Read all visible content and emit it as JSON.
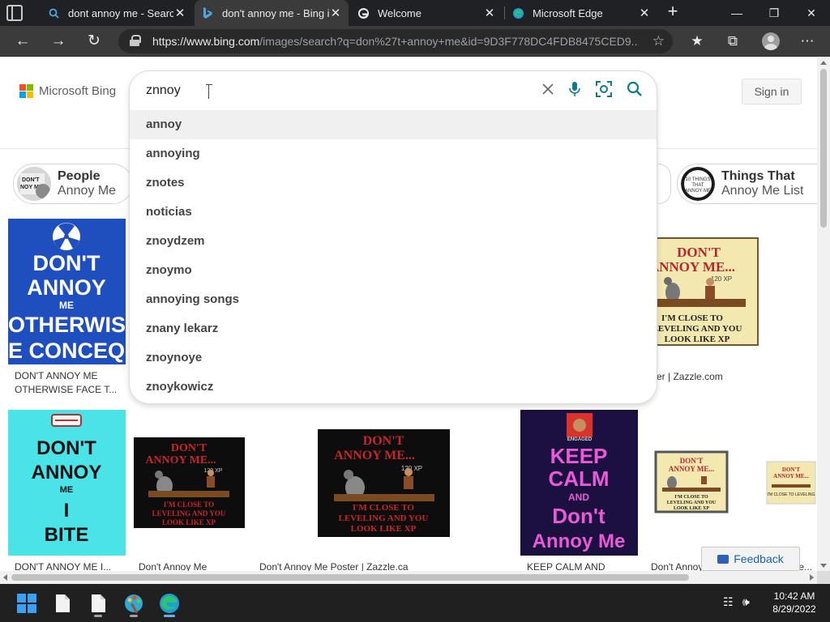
{
  "browser": {
    "tabs": [
      {
        "title": "dont annoy me - Search",
        "icon": "search-icon"
      },
      {
        "title": "don't annoy me - Bing images",
        "icon": "bing-icon"
      },
      {
        "title": "Welcome",
        "icon": "edge-icon"
      },
      {
        "title": "Microsoft Edge",
        "icon": "edge-icon"
      }
    ],
    "url_domain": "https://www.bing.com",
    "url_path": "/images/search?q=don%27t+annoy+me&id=9D3F778DC4FDB8475CED9..."
  },
  "page": {
    "brand": "Microsoft Bing",
    "sign_in": "Sign in",
    "feedback": "Feedback"
  },
  "search": {
    "query": "znnoy",
    "suggestions": [
      "annoy",
      "annoying",
      "znotes",
      "noticias",
      "znoydzem",
      "znoymo",
      "annoying songs",
      "znany lekarz",
      "znoynoye",
      "znoykowicz"
    ]
  },
  "chips": [
    {
      "line1": "People",
      "line2": "Annoy Me"
    },
    {
      "line1": "Things That",
      "line2": "Annoy Me List"
    }
  ],
  "chip_thumbs": {
    "things_list": [
      "10 THINGS",
      "THAT",
      "ANNOY ME"
    ],
    "people": [
      "DON'T",
      "NOY ME"
    ]
  },
  "results_row1": [
    {
      "caption": "DON'T ANNOY ME OTHERWISE FACE T...",
      "poster": [
        "DON'T",
        "ANNOY",
        "ME",
        "OTHERWISE",
        "E CONCEQU"
      ]
    },
    {
      "caption": "er | Zazzle.com",
      "poster": [
        "DON'T",
        "ANNOY ME...",
        "120 XP",
        "I'M CLOSE TO",
        "LEVELING AND YOU",
        "LOOK LIKE XP"
      ]
    }
  ],
  "results_row2": [
    {
      "caption": "DON'T ANNOY ME I...",
      "poster": [
        "DON'T",
        "ANNOY",
        "ME",
        "I",
        "BITE"
      ]
    },
    {
      "caption": "Don't Annoy Me Poster...",
      "poster": [
        "DON'T",
        "ANNOY ME...",
        "120 XP",
        "I'M CLOSE TO",
        "LEVELING AND YOU",
        "LOOK LIKE XP"
      ]
    },
    {
      "caption": "Don't Annoy Me Poster | Zazzle.ca",
      "poster": [
        "DON'T",
        "ANNOY ME...",
        "120 XP",
        "I'M CLOSE TO",
        "LEVELING AND YOU",
        "LOOK LIKE XP"
      ]
    },
    {
      "caption": "KEEP CALM AND Don't...",
      "poster": [
        "ENGAGED",
        "KEEP",
        "CALM",
        "AND",
        "Don't",
        "Annoy Me"
      ]
    },
    {
      "caption": "Don't Annoy...",
      "poster": [
        "DON'T",
        "ANNOY ME...",
        "I'M CLOSE TO",
        "LEVELING AND YOU",
        "LOOK LIKE XP"
      ]
    },
    {
      "caption": "y Me...",
      "poster": [
        "DON'T",
        "ANNOY ME...",
        "I'M CLOSE TO LEVELING"
      ]
    }
  ],
  "taskbar": {
    "time": "10:42 AM",
    "date": "8/29/2022"
  },
  "colors": {
    "bing_red": "#f25022",
    "bing_green": "#7fba00",
    "bing_blue": "#00a4ef",
    "bing_yellow": "#ffb900",
    "search_accent": "#0e7a8a",
    "edge_blue": "#1a73e8"
  }
}
